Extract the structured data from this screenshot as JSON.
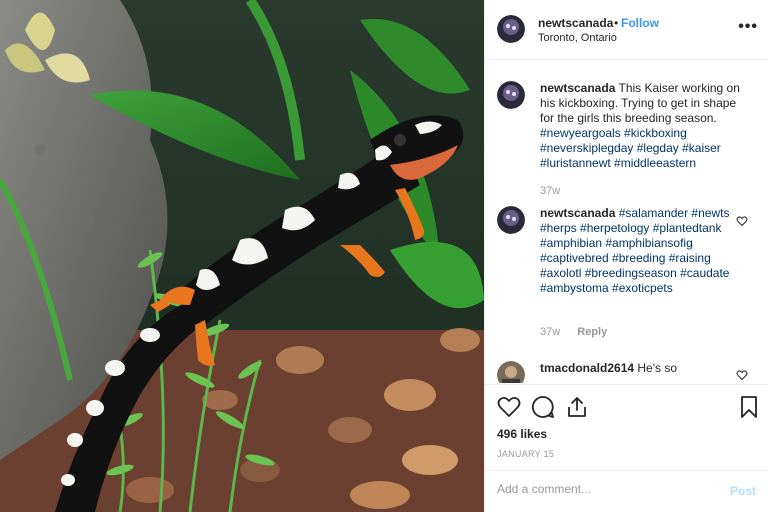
{
  "post": {
    "username": "newtscanada",
    "follow_label": "Follow",
    "dot": "•",
    "location": "Toronto, Ontario",
    "more_label": "•••",
    "photo_icon": "newt-photo"
  },
  "comments": [
    {
      "username": "newtscanada",
      "text": "This Kaiser working on his kickboxing. Trying to get in shape for the girls this breeding season.",
      "tags": "#newyeargoals #kickboxing #neverskiplegday #legday #kaiser #luristannewt #middleeastern",
      "time": "37w"
    },
    {
      "username": "newtscanada",
      "text": "",
      "tags": "#salamander #newts #herps #herpetology #plantedtank #amphibian #amphibiansofig #captivebred #breeding #raising #axolotl #breedingseason #caudate #ambystoma #exoticpets",
      "time": "37w",
      "reply_label": "Reply"
    },
    {
      "username": "tmacdonald2614",
      "text": "He's so",
      "tags": "",
      "time": ""
    }
  ],
  "actions": {
    "likes": "496 likes",
    "date": "JANUARY 15"
  },
  "add_comment": {
    "placeholder": "Add a comment...",
    "post_label": "Post"
  },
  "colors": {
    "accent": "#3897f0",
    "hashtag": "#003569",
    "post_disabled": "#b2dffc",
    "newt_orange": "#e8761f"
  }
}
